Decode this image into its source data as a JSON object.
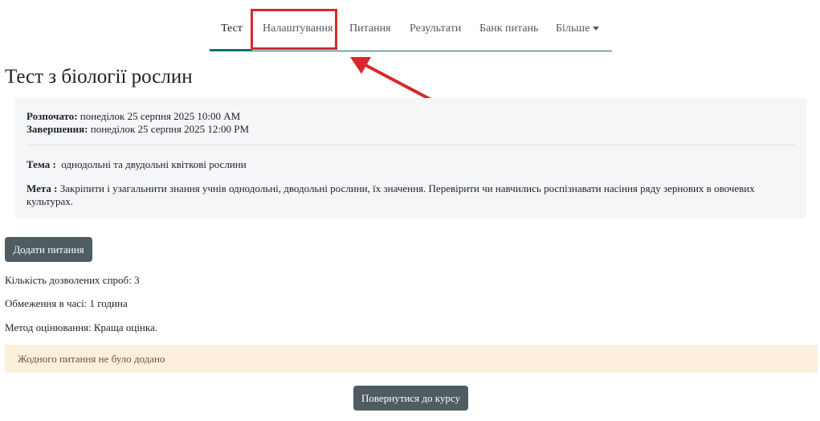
{
  "nav": {
    "tabs": [
      {
        "label": "Тест"
      },
      {
        "label": "Налаштування"
      },
      {
        "label": "Питання"
      },
      {
        "label": "Результати"
      },
      {
        "label": "Банк питань"
      },
      {
        "label": "Більше"
      }
    ],
    "active_tab": "Тест"
  },
  "page_title": "Тест з біології рослин",
  "info": {
    "opened_label": "Розпочато:",
    "opened_value": "понеділок 25 серпня 2025 10:00 AM",
    "closed_label": "Завершення:",
    "closed_value": "понеділок 25 серпня 2025 12:00 PM",
    "topic_label": "Тема :",
    "topic_value": "однодольні та двудольні квіткові рослини",
    "goal_label": "Мета :",
    "goal_value": "Закріпити і узагальнити знання учнів однодольні, дводольні рослини, їх значення. Перевірити чи навчились роспізнавати насіння ряду зернових в овочевих культурах."
  },
  "add_question_button": "Додати питання",
  "attempts_text": "Кількість дозволених спроб: 3",
  "time_limit_text": "Обмеження в часі: 1 година",
  "grading_text": "Метод оцінювання: Краща оцінка.",
  "alert_text": "Жодного питання не було додано",
  "back_button": "Повернутися до курсу",
  "colors": {
    "accent_underline": "#0f6e76",
    "button_bg": "#4f5d63",
    "alert_bg": "#fcefdc",
    "annotation_red": "#d42a2a"
  }
}
